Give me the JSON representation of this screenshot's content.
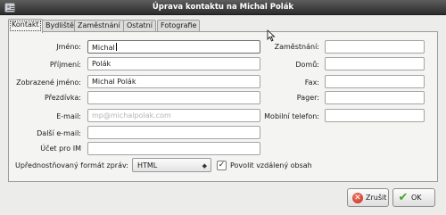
{
  "window": {
    "title": "Úprava kontaktu na Michal Polák"
  },
  "tabs": [
    {
      "label": "Kontakt",
      "active": true
    },
    {
      "label": "Bydliště",
      "active": false
    },
    {
      "label": "Zaměstnání",
      "active": false
    },
    {
      "label": "Ostatní",
      "active": false
    },
    {
      "label": "Fotografie",
      "active": false
    }
  ],
  "contact": {
    "labels": {
      "first_name": "Jméno:",
      "surname": "Příjmení:",
      "display_name": "Zobrazené jméno:",
      "nickname": "Přezdívka:",
      "email": "E-mail:",
      "other_email": "Další e-mail:",
      "im_account": "Účet pro IM"
    },
    "values": {
      "first_name": "Michal",
      "surname": "Polák",
      "display_name": "Michal  Polák",
      "nickname": "",
      "email": "mp@michalpolak.com",
      "other_email": "",
      "im_account": ""
    }
  },
  "phones": {
    "labels": {
      "work": "Zaměstnání:",
      "home": "Domů:",
      "fax": "Fax:",
      "pager": "Pager:",
      "mobile": "Mobilní telefon:"
    },
    "values": {
      "work": "",
      "home": "",
      "fax": "",
      "pager": "",
      "mobile": ""
    }
  },
  "preferences": {
    "format_label": "Upřednostňovaný formát zpráv:",
    "format_value": "HTML",
    "remote_label": "Povolit vzdálený obsah",
    "remote_checked": true,
    "check_mark": "✓",
    "combo_arrow": "◆"
  },
  "buttons": {
    "cancel": "Zrušit",
    "ok": "OK",
    "cancel_icon": "✕",
    "ok_icon": "✔"
  }
}
